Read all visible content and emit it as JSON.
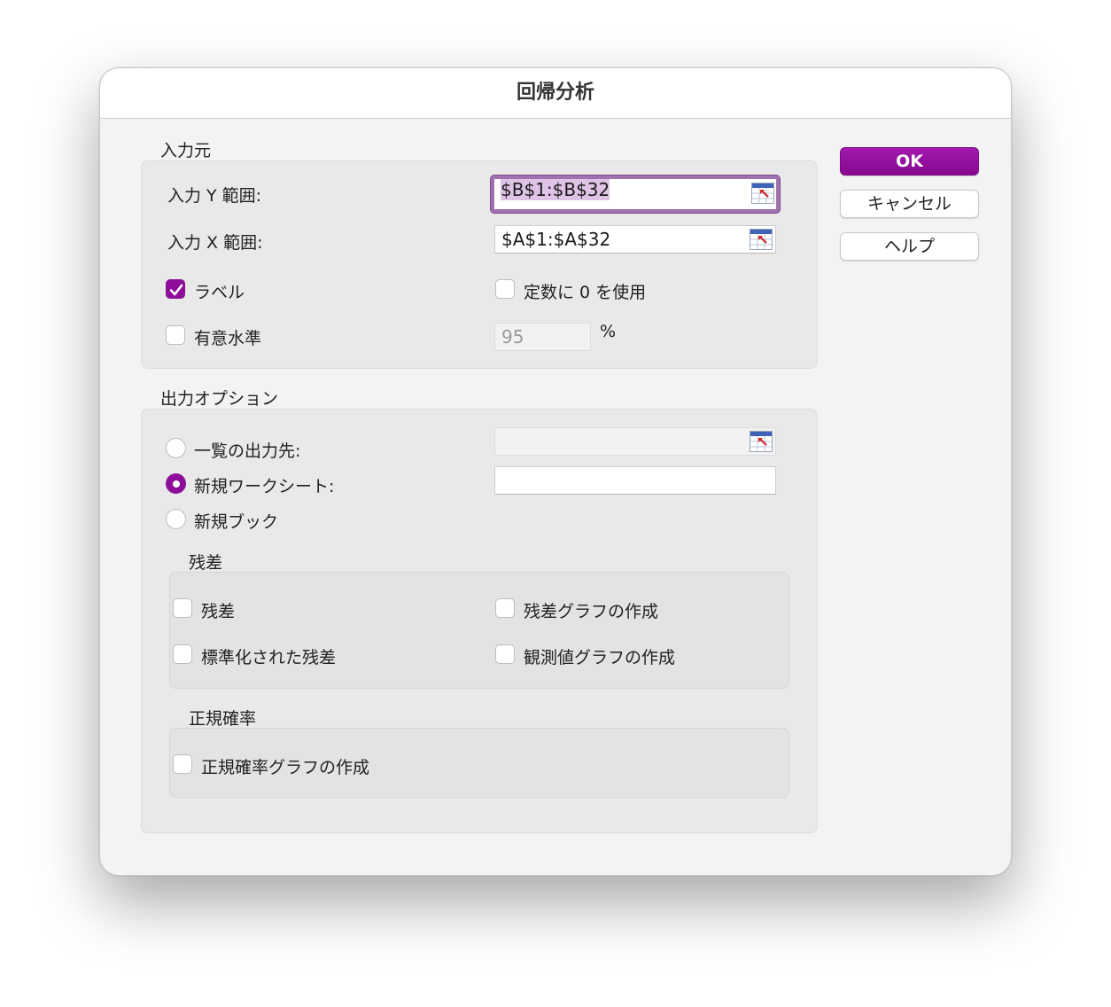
{
  "dialog": {
    "title": "回帰分析"
  },
  "input": {
    "section_label": "入力元",
    "y_range_label": "入力 Y 範囲:",
    "y_range_value": "$B$1:$B$32",
    "x_range_label": "入力 X 範囲:",
    "x_range_value": "$A$1:$A$32",
    "labels_label": "ラベル",
    "labels_checked": true,
    "constant_zero_label": "定数に 0 を使用",
    "constant_zero_checked": false,
    "confidence_label": "有意水準",
    "confidence_checked": false,
    "confidence_value": "95",
    "percent_sign": "%"
  },
  "output": {
    "section_label": "出力オプション",
    "output_range_label": "一覧の出力先:",
    "new_sheet_label": "新規ワークシート:",
    "new_workbook_label": "新規ブック",
    "selected_option": "new_sheet",
    "output_range_value": "",
    "new_sheet_value": ""
  },
  "residuals": {
    "section_label": "残差",
    "residuals_label": "残差",
    "residual_plots_label": "残差グラフの作成",
    "standardized_label": "標準化された残差",
    "line_fit_label": "観測値グラフの作成"
  },
  "normal_probability": {
    "section_label": "正規確率",
    "plots_label": "正規確率グラフの作成"
  },
  "buttons": {
    "ok": "OK",
    "cancel": "キャンセル",
    "help": "ヘルプ"
  },
  "colors": {
    "accent": "#8e0e99",
    "focus_ring": "#a070b0",
    "selection": "#dfc3e6"
  },
  "icons": {
    "range_picker": "collapse-dialog-icon",
    "checkmark": "checkmark-icon"
  }
}
